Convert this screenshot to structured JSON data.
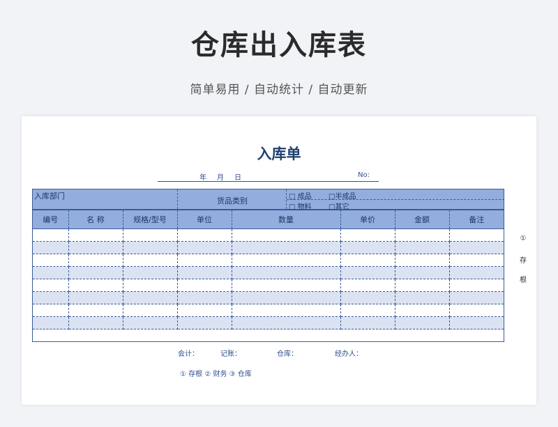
{
  "page": {
    "title": "仓库出入库表",
    "subtitle": "简单易用  /  自动统计  /  自动更新"
  },
  "form": {
    "title": "入库单",
    "date_year": "年",
    "date_month": "月",
    "date_day": "日",
    "number_label": "No:",
    "dept_label": "入库部门",
    "category_label": "货品类别",
    "options": [
      "□ 成品",
      "□半成品",
      "□ 物料",
      "□其它"
    ],
    "columns": [
      "编号",
      "名  称",
      "规格/型号",
      "单位",
      "数量",
      "单价",
      "金额",
      "备注"
    ],
    "empty_rows": 8,
    "side_note": [
      "①",
      "存",
      "根"
    ],
    "sign_fields": [
      "会计：",
      "记账：",
      "仓库：",
      "经办人："
    ],
    "copies": "① 存根   ② 财务   ③ 仓库"
  },
  "colors": {
    "header_fill": "#93aede",
    "row_alt": "#dbe3f2",
    "border": "#3a5a9a",
    "title": "#1f3f6e"
  }
}
